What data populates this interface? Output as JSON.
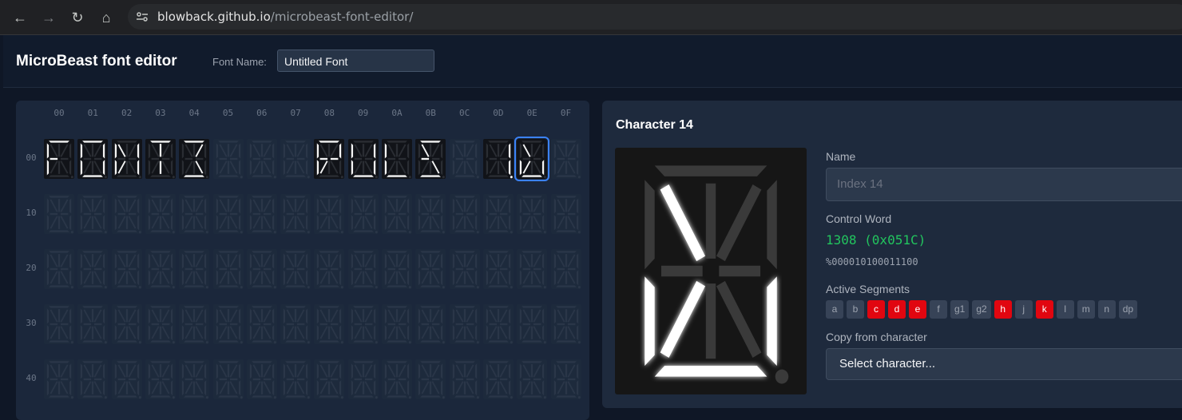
{
  "browser": {
    "url_host": "blowback.github.io",
    "url_path": "/microbeast-font-editor/"
  },
  "app": {
    "title": "MicroBeast font editor",
    "font_name_label": "Font Name:",
    "font_name_value": "Untitled Font"
  },
  "grid": {
    "columns": [
      "00",
      "01",
      "02",
      "03",
      "04",
      "05",
      "06",
      "07",
      "08",
      "09",
      "0A",
      "0B",
      "0C",
      "0D",
      "0E",
      "0F"
    ],
    "rows": [
      "00",
      "10",
      "20",
      "30",
      "40"
    ],
    "selected_index": 14,
    "glyphs": {
      "0": [
        "a",
        "e",
        "f",
        "g1"
      ],
      "1": [
        "a",
        "b",
        "c",
        "d",
        "e",
        "f"
      ],
      "2": [
        "b",
        "c",
        "e",
        "f",
        "h",
        "k"
      ],
      "3": [
        "a",
        "i",
        "l"
      ],
      "4": [
        "a",
        "d",
        "j",
        "m"
      ],
      "8": [
        "a",
        "b",
        "e",
        "f",
        "g1",
        "g2",
        "k"
      ],
      "9": [
        "b",
        "c",
        "d",
        "e",
        "f"
      ],
      "10": [
        "d",
        "e",
        "f"
      ],
      "11": [
        "a",
        "d",
        "g1",
        "h",
        "m"
      ],
      "13": [
        "b",
        "c",
        "dp"
      ],
      "14": [
        "c",
        "d",
        "e",
        "h",
        "k"
      ]
    }
  },
  "detail": {
    "title": "Character 14",
    "name_label": "Name",
    "name_placeholder": "Index 14",
    "control_word_label": "Control Word",
    "control_word": "1308 (0x051C)",
    "binary": "%000010100011100",
    "active_segments_label": "Active Segments",
    "segments": [
      {
        "name": "a",
        "on": false
      },
      {
        "name": "b",
        "on": false
      },
      {
        "name": "c",
        "on": true
      },
      {
        "name": "d",
        "on": true
      },
      {
        "name": "e",
        "on": true
      },
      {
        "name": "f",
        "on": false
      },
      {
        "name": "g1",
        "on": false
      },
      {
        "name": "g2",
        "on": false
      },
      {
        "name": "h",
        "on": true
      },
      {
        "name": "j",
        "on": false
      },
      {
        "name": "k",
        "on": true
      },
      {
        "name": "l",
        "on": false
      },
      {
        "name": "m",
        "on": false
      },
      {
        "name": "n",
        "on": false
      },
      {
        "name": "dp",
        "on": false
      }
    ],
    "copy_label": "Copy from character",
    "copy_select": "Select character..."
  },
  "colors": {
    "segment_on": "#ffffff",
    "segment_off": "#3a3a3a",
    "active_badge": "#e10610",
    "accent": "#3b82f6",
    "control_word": "#22c55e"
  }
}
